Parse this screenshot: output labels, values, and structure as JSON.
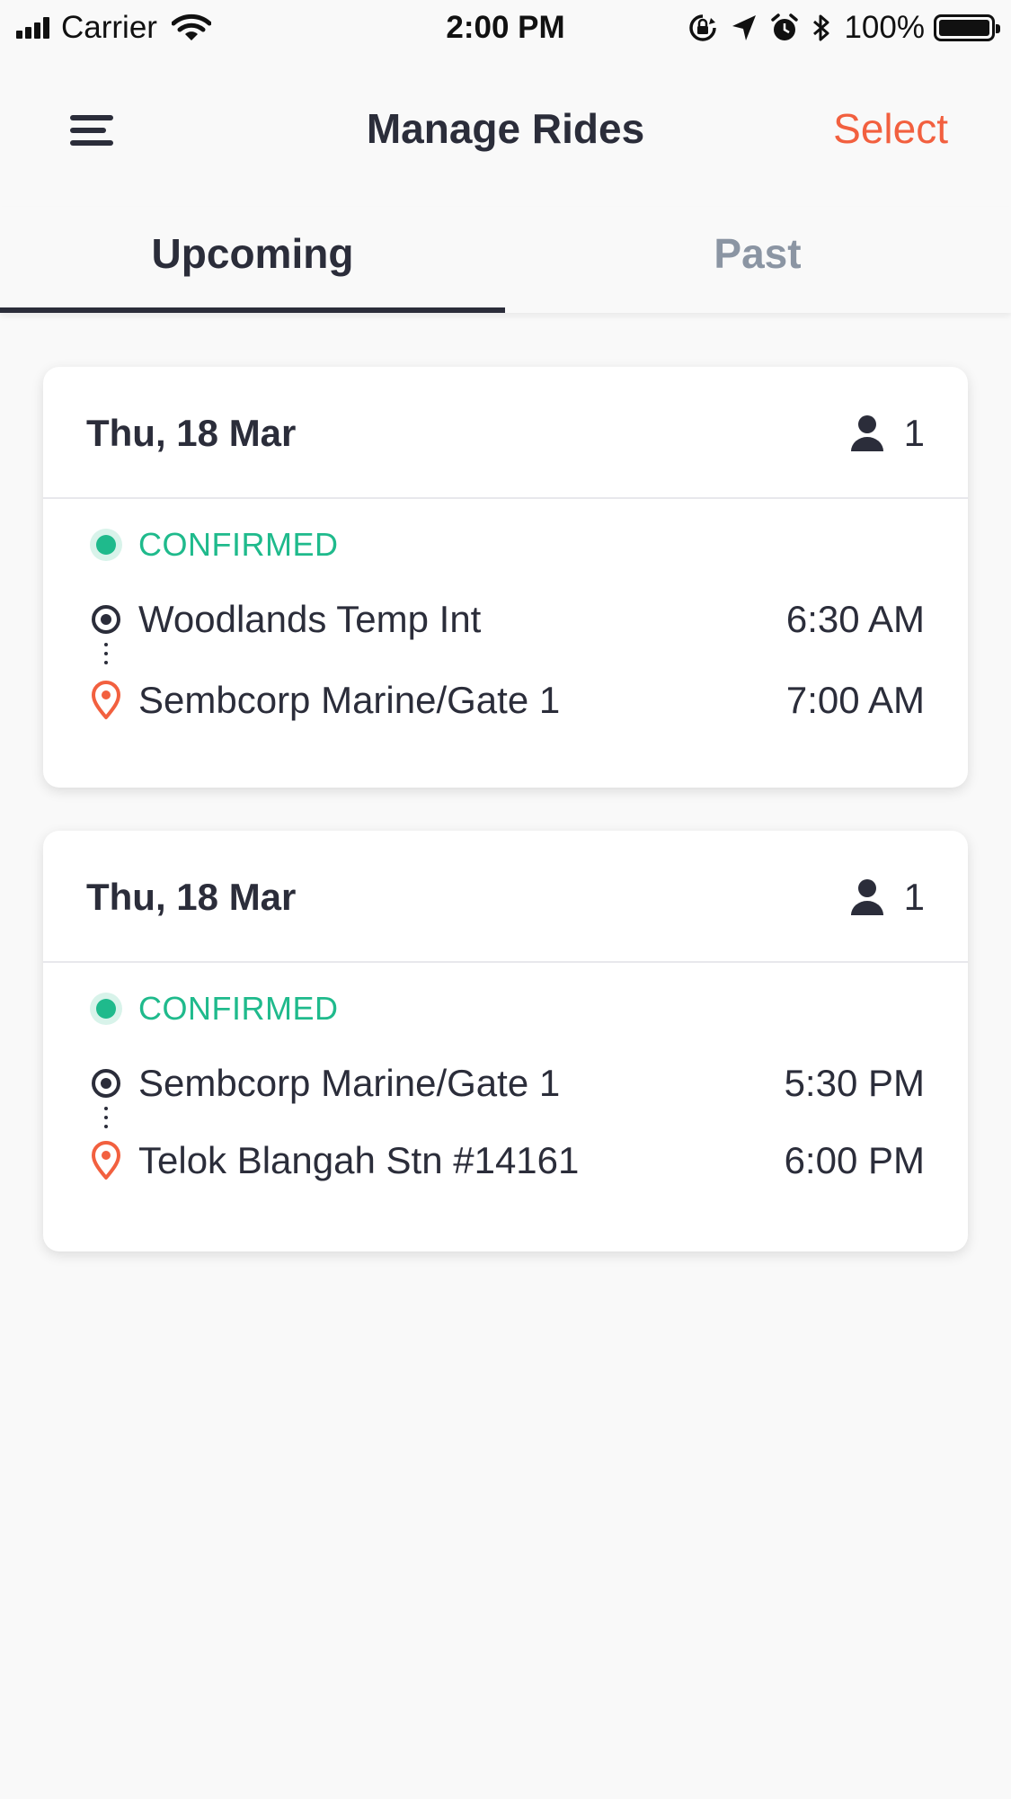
{
  "status_bar": {
    "carrier": "Carrier",
    "time": "2:00 PM",
    "battery": "100%"
  },
  "header": {
    "title": "Manage Rides",
    "select_label": "Select"
  },
  "tabs": [
    {
      "label": "Upcoming",
      "active": true
    },
    {
      "label": "Past",
      "active": false
    }
  ],
  "rides": [
    {
      "date": "Thu, 18 Mar",
      "passengers": "1",
      "status": "CONFIRMED",
      "pickup": {
        "name": "Woodlands Temp Int",
        "time": "6:30 AM"
      },
      "dropoff": {
        "name": "Sembcorp Marine/Gate 1",
        "time": "7:00 AM"
      }
    },
    {
      "date": "Thu, 18 Mar",
      "passengers": "1",
      "status": "CONFIRMED",
      "pickup": {
        "name": "Sembcorp Marine/Gate 1",
        "time": "5:30 PM"
      },
      "dropoff": {
        "name": "Telok Blangah Stn #14161",
        "time": "6:00 PM"
      }
    }
  ],
  "colors": {
    "accent": "#f2603f",
    "confirmed": "#1fba8c",
    "text": "#2b2d3a",
    "inactive_tab": "#8b95a3"
  }
}
